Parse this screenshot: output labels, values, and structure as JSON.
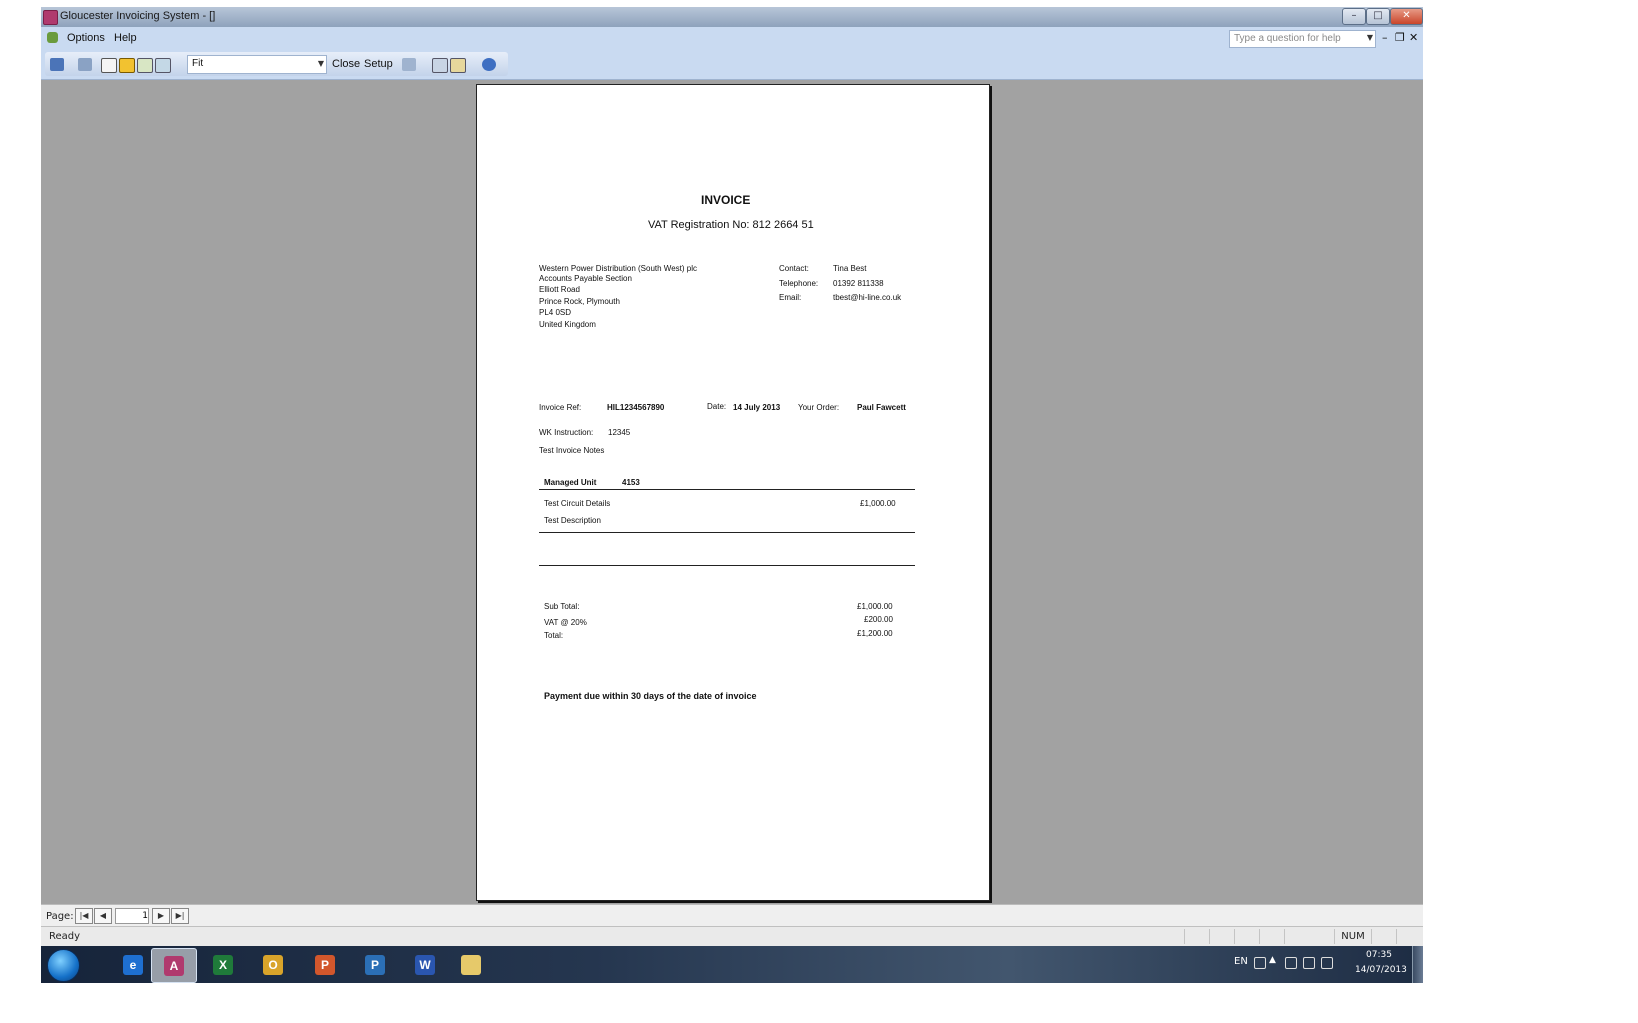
{
  "window": {
    "title": "Gloucester Invoicing System - []",
    "controls": {
      "minimize": "–",
      "maximize": "□",
      "close": "✕"
    }
  },
  "menu": {
    "items": [
      "Options",
      "Help"
    ],
    "help_placeholder": "Type a question for help",
    "mdi_minimize": "–",
    "mdi_restore": "❐",
    "mdi_close": "✕"
  },
  "toolbar": {
    "zoom_value": "Fit",
    "close_label": "Close",
    "setup_label": "Setup"
  },
  "invoice": {
    "heading": "INVOICE",
    "vat_registration": "VAT Registration No: 812 2664 51",
    "address_lines": [
      "Western Power Distribution (South West) plc",
      "Accounts Payable Section",
      "Elliott Road",
      "Prince Rock, Plymouth",
      "PL4 0SD",
      "United Kingdom"
    ],
    "contact_label": "Contact:",
    "contact_value": "Tina Best",
    "telephone_label": "Telephone:",
    "telephone_value": "01392 811338",
    "email_label": "Email:",
    "email_value": "tbest@hi-line.co.uk",
    "ref_label": "Invoice Ref:",
    "ref_value": "HIL1234567890",
    "date_label": "Date:",
    "date_value": "14 July 2013",
    "order_label": "Your Order:",
    "order_value": "Paul Fawcett",
    "wk_label": "WK Instruction:",
    "wk_value": "12345",
    "notes": "Test Invoice Notes",
    "managed_unit_label": "Managed Unit",
    "managed_unit_value": "4153",
    "circuit_details": "Test Circuit Details",
    "line_amount": "£1,000.00",
    "description": "Test Description",
    "subtotal_label": "Sub Total:",
    "subtotal_value": "£1,000.00",
    "vat_label": "VAT @ 20%",
    "vat_value": "£200.00",
    "total_label": "Total:",
    "total_value": "£1,200.00",
    "payment_terms": "Payment due within 30 days of the date of invoice"
  },
  "pagenav": {
    "label": "Page:",
    "current_page": "1",
    "first": "|◀",
    "prev": "◀",
    "next": "▶",
    "last": "▶|"
  },
  "status": {
    "text": "Ready",
    "indicator": "NUM"
  },
  "taskbar": {
    "apps": [
      {
        "name": "internet-explorer",
        "glyph": "e",
        "color": "#1e6fd0"
      },
      {
        "name": "access",
        "glyph": "A",
        "color": "#b03a6e",
        "active": true
      },
      {
        "name": "excel",
        "glyph": "X",
        "color": "#1f7a3a"
      },
      {
        "name": "outlook",
        "glyph": "O",
        "color": "#d9a42a"
      },
      {
        "name": "powerpoint",
        "glyph": "P",
        "color": "#d2572c"
      },
      {
        "name": "publisher",
        "glyph": "P",
        "color": "#2b6fb6"
      },
      {
        "name": "word",
        "glyph": "W",
        "color": "#2a56b0"
      },
      {
        "name": "explorer",
        "glyph": "",
        "color": "#e6c96a"
      }
    ],
    "language": "EN",
    "time": "07:35",
    "date": "14/07/2013"
  }
}
